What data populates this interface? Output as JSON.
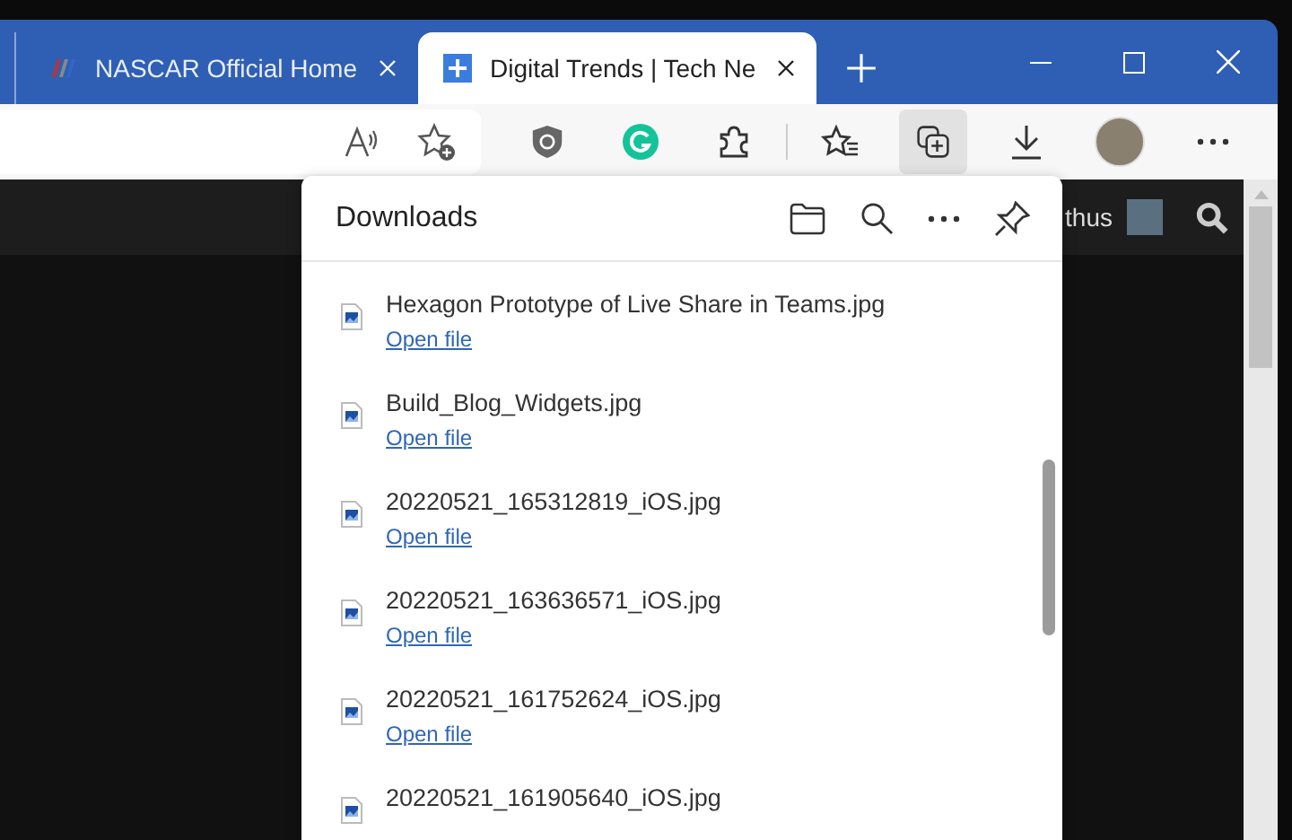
{
  "tabs": [
    {
      "title": "NASCAR Official Home",
      "selected": false
    },
    {
      "title": "Digital Trends | Tech Ne",
      "selected": true
    }
  ],
  "toolbar": [
    {
      "kind": "shield",
      "selected": false
    },
    {
      "kind": "grammar",
      "selected": false
    },
    {
      "kind": "puzzle",
      "selected": false
    },
    {
      "kind": "favorites",
      "selected": false
    },
    {
      "kind": "collections",
      "selected": true
    },
    {
      "kind": "download",
      "selected": false
    },
    {
      "kind": "profile",
      "selected": false
    },
    {
      "kind": "more",
      "selected": false
    }
  ],
  "page": {
    "user_name": "thus"
  },
  "downloads": {
    "title": "Downloads",
    "items": [
      {
        "name": "Hexagon Prototype of Live Share in Teams.jpg",
        "action": "Open file"
      },
      {
        "name": "Build_Blog_Widgets.jpg",
        "action": "Open file"
      },
      {
        "name": "20220521_165312819_iOS.jpg",
        "action": "Open file"
      },
      {
        "name": "20220521_163636571_iOS.jpg",
        "action": "Open file"
      },
      {
        "name": "20220521_161752624_iOS.jpg",
        "action": "Open file"
      },
      {
        "name": "20220521_161905640_iOS.jpg"
      }
    ]
  }
}
